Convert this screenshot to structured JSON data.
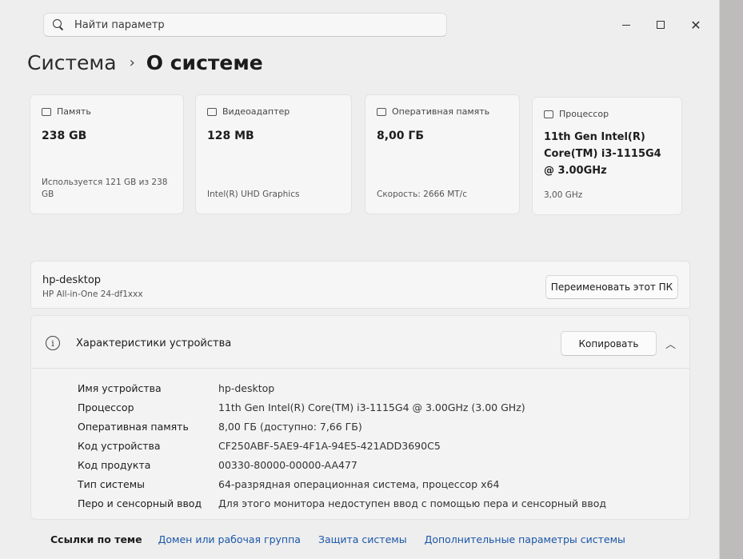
{
  "search": {
    "placeholder": "Найти параметр"
  },
  "window_controls": {
    "minimize": "minimize",
    "maximize": "maximize",
    "close": "✕"
  },
  "breadcrumb": {
    "parent": "Система",
    "separator": "›",
    "current": "О системе"
  },
  "cards": [
    {
      "icon": "storage-icon",
      "label": "Память",
      "value": "238 GB",
      "sub": "Используется 121 GB из 238 GB"
    },
    {
      "icon": "display-adapter-icon",
      "label": "Видеоадаптер",
      "value": "128 MB",
      "sub": "Intel(R) UHD Graphics"
    },
    {
      "icon": "ram-icon",
      "label": "Оперативная память",
      "value": "8,00 ГБ",
      "sub": "Скорость: 2666 MT/c"
    },
    {
      "icon": "processor-icon",
      "label": "Процессор",
      "value": "11th Gen Intel(R) Core(TM) i3-1115G4 @ 3.00GHz",
      "sub": "3,00 GHz"
    }
  ],
  "device": {
    "name": "hp-desktop",
    "model": "HP All-in-One 24-df1xxx",
    "rename_label": "Переименовать этот ПК"
  },
  "specs": {
    "title": "Характеристики устройства",
    "copy_label": "Копировать",
    "rows": [
      {
        "key": "Имя устройства",
        "value": "hp-desktop"
      },
      {
        "key": "Процессор",
        "value": "11th Gen Intel(R) Core(TM) i3-1115G4 @ 3.00GHz (3.00 GHz)"
      },
      {
        "key": "Оперативная память",
        "value": "8,00 ГБ (доступно: 7,66 ГБ)"
      },
      {
        "key": "Код устройства",
        "value": "CF250ABF-5AE9-4F1A-94E5-421ADD3690C5"
      },
      {
        "key": "Код продукта",
        "value": "00330-80000-00000-AA477"
      },
      {
        "key": "Тип системы",
        "value": "64-разрядная операционная система, процессор x64"
      },
      {
        "key": "Перо и сенсорный ввод",
        "value": "Для этого монитора недоступен ввод с помощью пера и сенсорный ввод"
      }
    ]
  },
  "links": {
    "label": "Ссылки по теме",
    "items": [
      "Домен или рабочая группа",
      "Защита системы",
      "Дополнительные параметры системы"
    ]
  },
  "colors": {
    "accent_link": "#1a56a8",
    "card_bg": "#f6f6f6",
    "window_bg": "#eeeeee"
  }
}
